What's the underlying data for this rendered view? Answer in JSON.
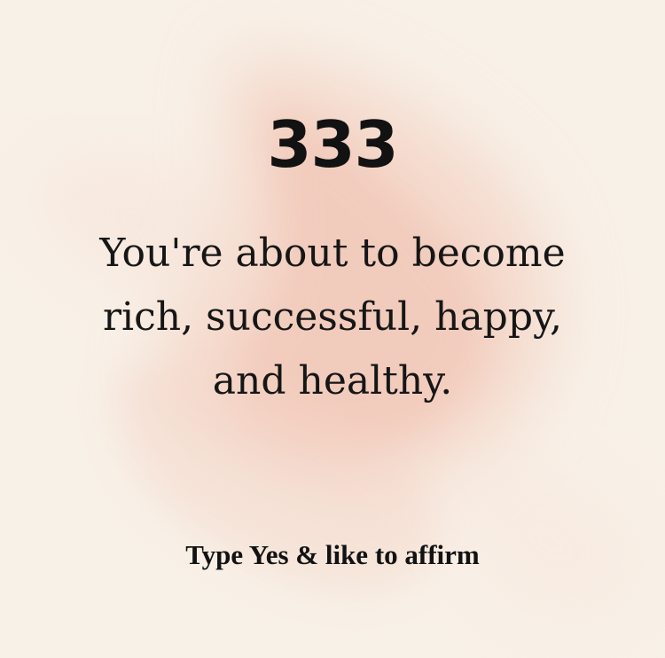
{
  "card": {
    "number": "333",
    "message_lines": [
      "You're about to become",
      "rich, successful, happy,",
      "and healthy."
    ],
    "cta": "Type Yes & like to affirm"
  },
  "colors": {
    "background": "#f8f1e8",
    "brush": "#f1c7b4",
    "text": "#121212"
  }
}
